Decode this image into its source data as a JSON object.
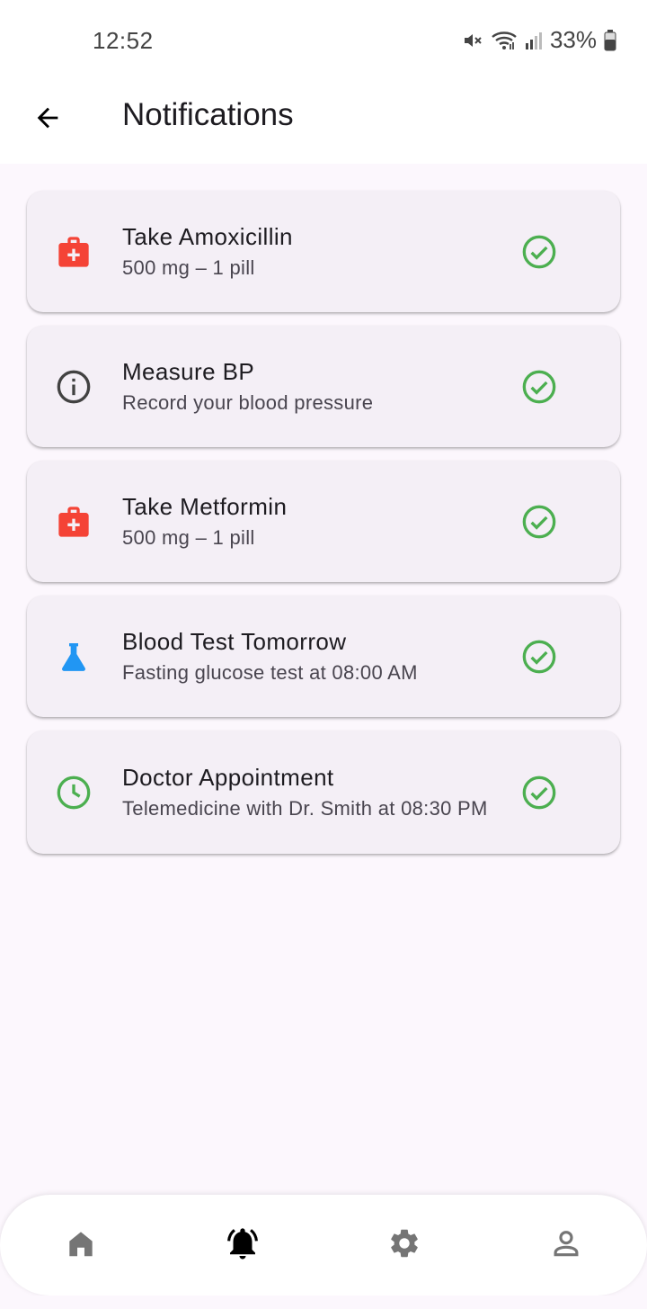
{
  "status_bar": {
    "time": "12:52",
    "battery": "33%"
  },
  "app_bar": {
    "title": "Notifications"
  },
  "notifications": [
    {
      "title": "Take Amoxicillin",
      "subtitle": "500 mg – 1 pill",
      "icon": "medical-kit-icon",
      "icon_color": "#f44336"
    },
    {
      "title": "Measure BP",
      "subtitle": "Record your blood pressure",
      "icon": "info-icon",
      "icon_color": "#424242"
    },
    {
      "title": "Take Metformin",
      "subtitle": "500 mg – 1 pill",
      "icon": "medical-kit-icon",
      "icon_color": "#f44336"
    },
    {
      "title": "Blood Test Tomorrow",
      "subtitle": "Fasting glucose test at 08:00 AM",
      "icon": "flask-icon",
      "icon_color": "#2196f3"
    },
    {
      "title": "Doctor Appointment",
      "subtitle": "Telemedicine with Dr. Smith at 08:30 PM",
      "icon": "clock-icon",
      "icon_color": "#4caf50"
    }
  ],
  "done_icon": {
    "name": "check-circle-icon",
    "color": "#4caf50"
  },
  "bottom_nav": {
    "items": [
      {
        "icon": "home-icon",
        "active": false
      },
      {
        "icon": "bell-icon",
        "active": true
      },
      {
        "icon": "gear-icon",
        "active": false
      },
      {
        "icon": "person-icon",
        "active": false
      }
    ],
    "active_color": "#000000",
    "inactive_color": "#757575"
  }
}
